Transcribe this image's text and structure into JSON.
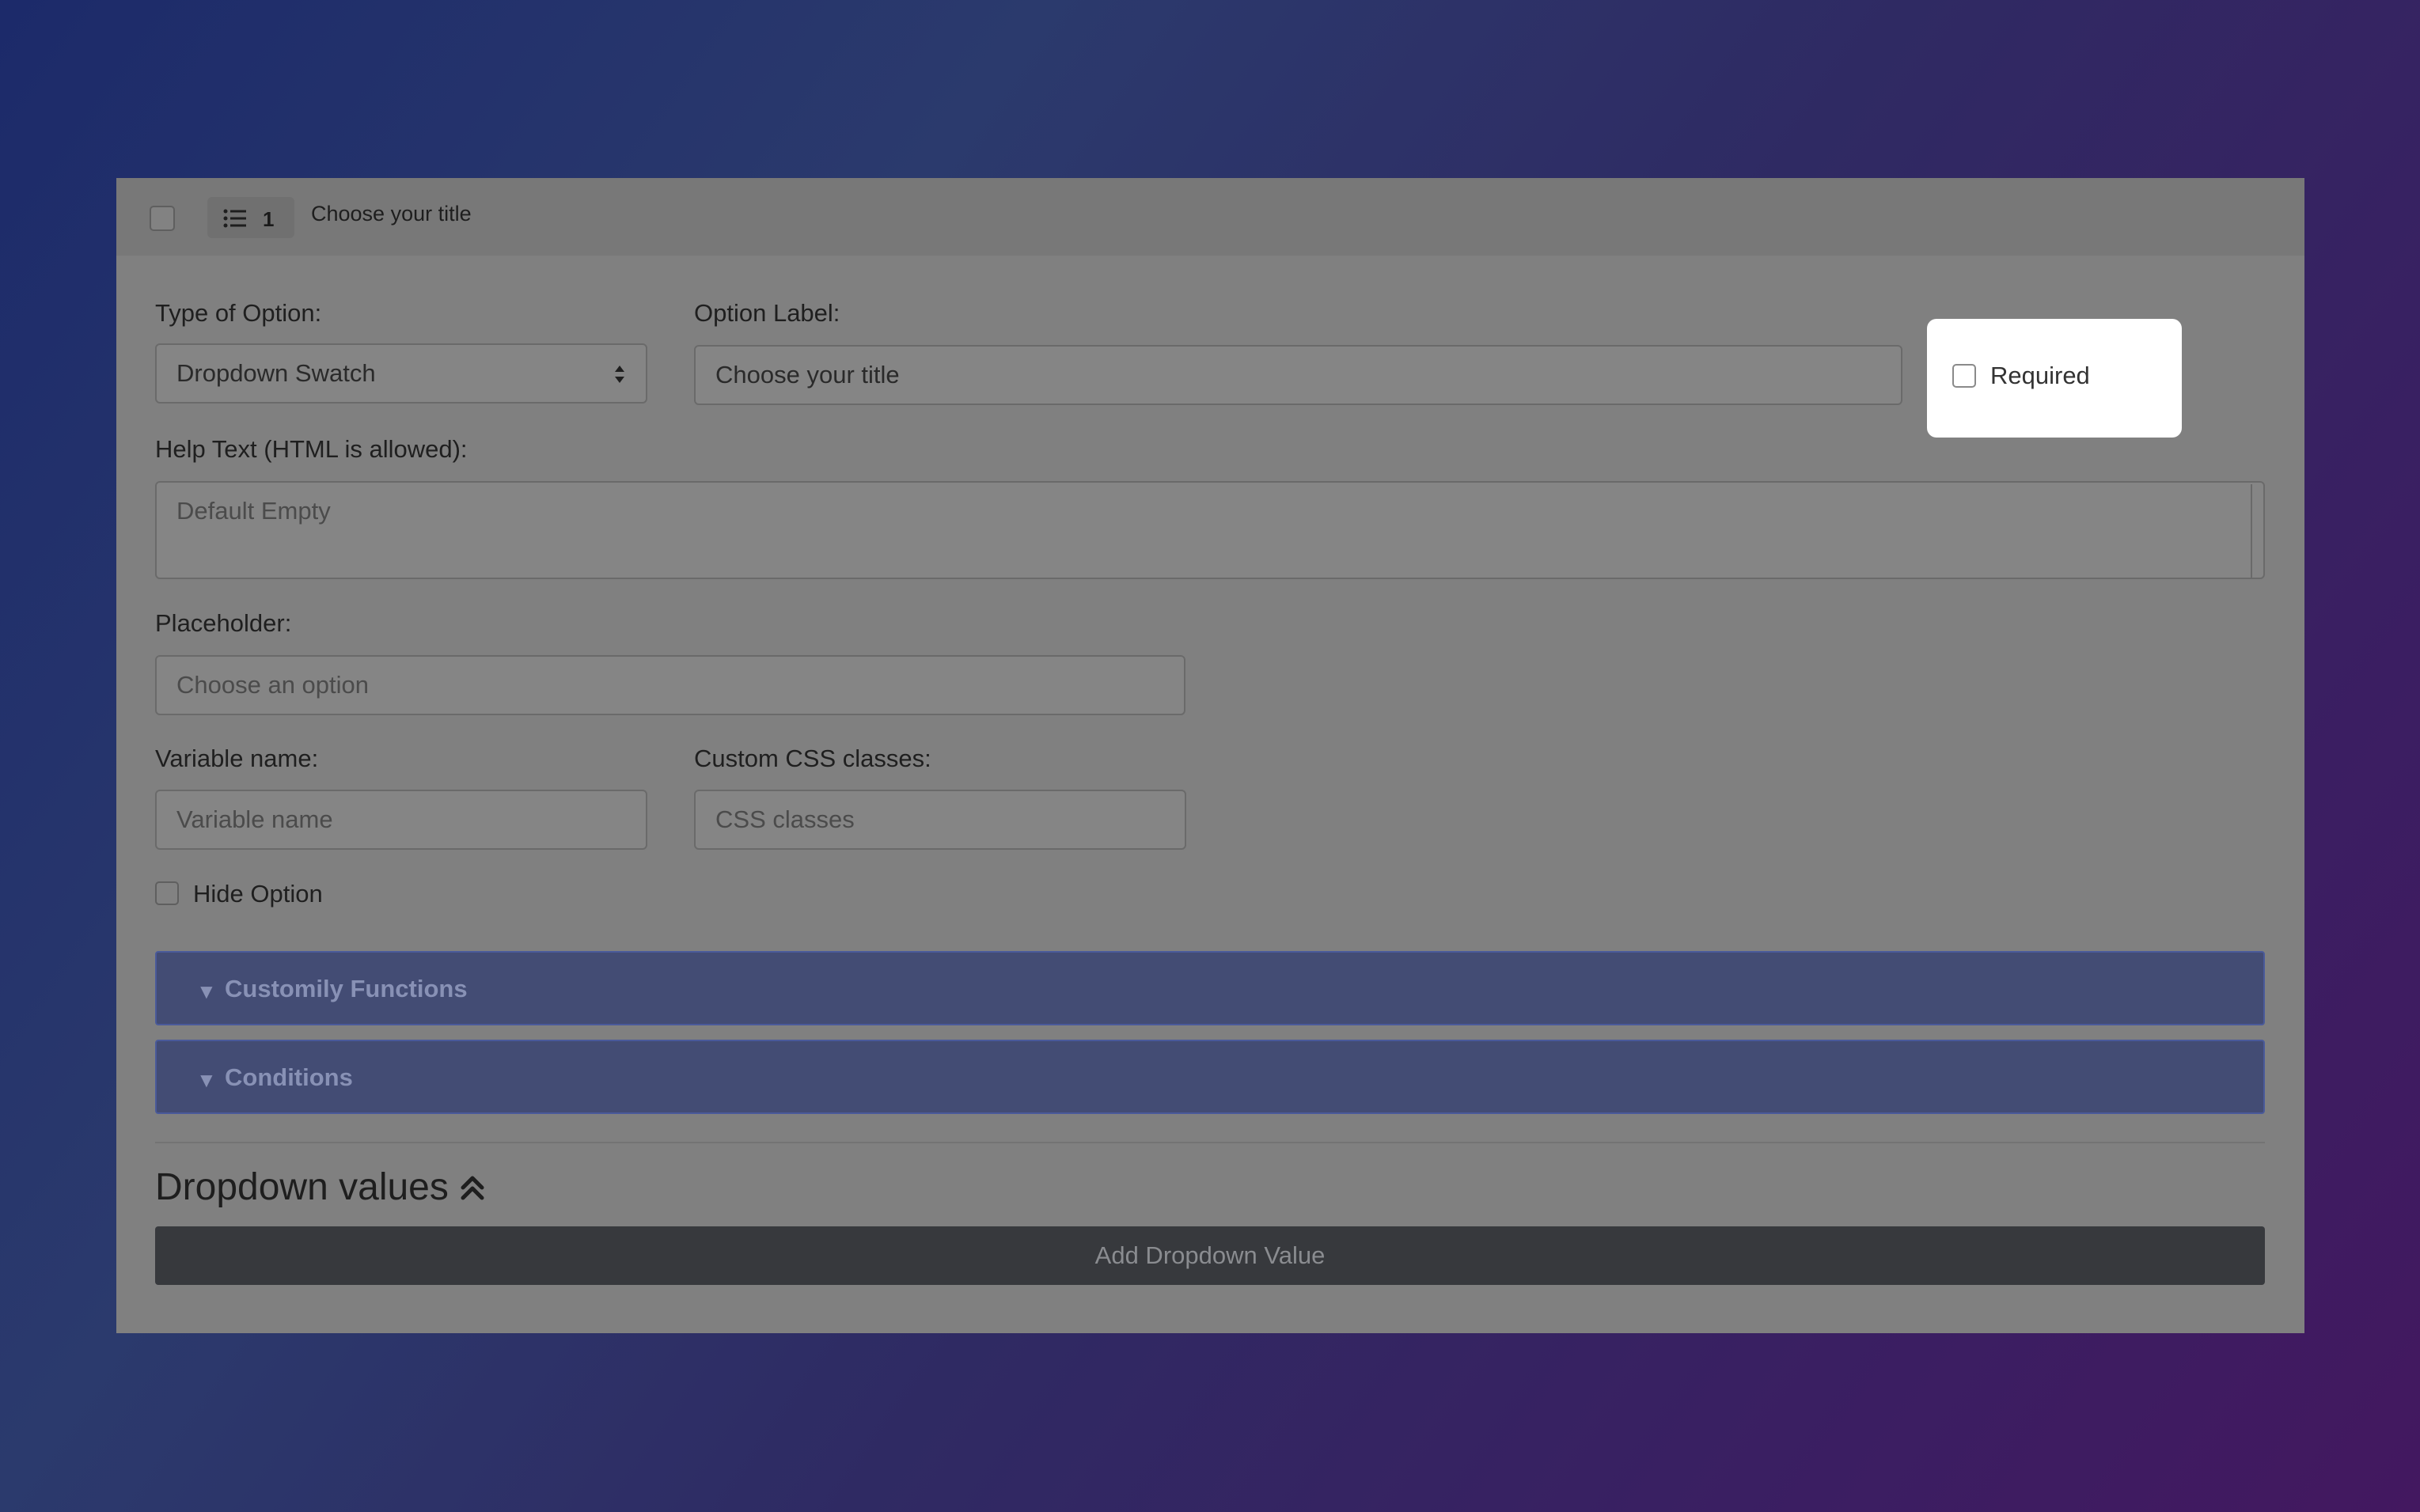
{
  "header": {
    "badge_number": "1",
    "title": "Choose your title"
  },
  "form": {
    "type_of_option": {
      "label": "Type of Option:",
      "selected": "Dropdown Swatch"
    },
    "option_label": {
      "label": "Option Label:",
      "value": "Choose your title"
    },
    "required": {
      "label": "Required",
      "checked": false
    },
    "help_text": {
      "label": "Help Text (HTML is allowed):",
      "placeholder": "Default Empty"
    },
    "placeholder": {
      "label": "Placeholder:",
      "placeholder": "Choose an option"
    },
    "variable_name": {
      "label": "Variable name:",
      "placeholder": "Variable name"
    },
    "custom_css": {
      "label": "Custom CSS classes:",
      "placeholder": "CSS classes"
    },
    "hide_option": {
      "label": "Hide Option",
      "checked": false
    }
  },
  "accordions": [
    {
      "arrow": "▼",
      "label": "Customily Functions"
    },
    {
      "arrow": "▼",
      "label": "Conditions"
    }
  ],
  "dropdown_values": {
    "title": "Dropdown values",
    "toggle_icon": "double-chevron-up-icon",
    "add_button_label": "Add Dropdown Value"
  },
  "colors": {
    "accordion_bg": "#434c74",
    "button_bg": "#37393d",
    "card_bg": "#808080"
  }
}
